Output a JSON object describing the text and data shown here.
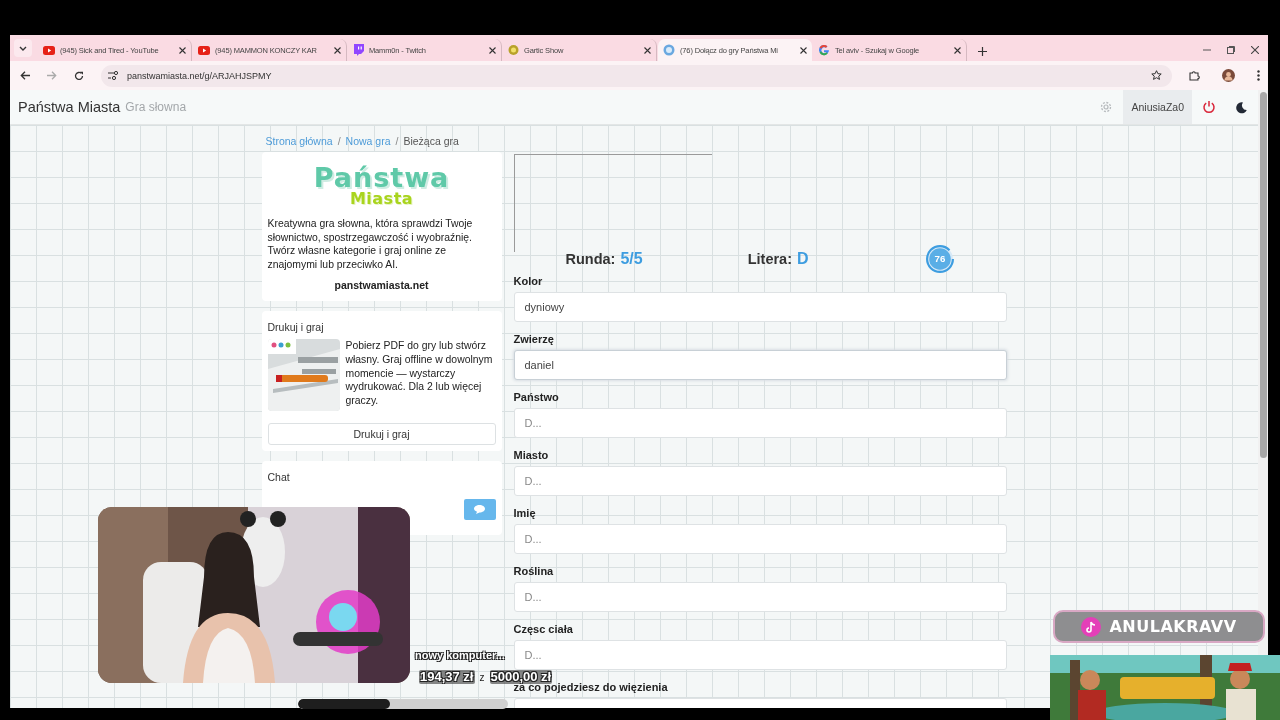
{
  "browser": {
    "tabs": [
      {
        "title": "(945) Sick and Tired - YouTube",
        "kind": "youtube",
        "selected": false
      },
      {
        "title": "(945) MAMMON KONCZY KAR",
        "kind": "youtube",
        "selected": false
      },
      {
        "title": "Mamm0n - Twitch",
        "kind": "twitch",
        "selected": false
      },
      {
        "title": "Gartic Show",
        "kind": "gartic",
        "selected": false
      },
      {
        "title": "(76) Dołącz do gry Państwa Mi",
        "kind": "site",
        "selected": true
      },
      {
        "title": "Tel aviv - Szukaj w Google",
        "kind": "google",
        "selected": false
      }
    ],
    "url": "panstwamiasta.net/g/ARJAHJSPMY"
  },
  "header": {
    "title": "Państwa Miasta",
    "subtitle": "Gra słowna",
    "user": "AniusiaZa0"
  },
  "breadcrumb": [
    {
      "label": "Strona główna",
      "kind": "link"
    },
    {
      "label": "/",
      "kind": "separator"
    },
    {
      "label": "Nowa gra",
      "kind": "link"
    },
    {
      "label": "/",
      "kind": "separator"
    },
    {
      "label": "Bieżąca gra",
      "kind": "current"
    }
  ],
  "logo": {
    "line_1": "Państwa",
    "line_2": "Miasta"
  },
  "intro": {
    "text": "Kreatywna gra słowna, która sprawdzi Twoje słownictwo, spostrzegawczość i wyobraźnię. Twórz własne kategorie i graj online ze znajomymi lub przeciwko AI.",
    "site": "panstwamiasta.net"
  },
  "print_card": {
    "title": "Drukuj i graj",
    "text": "Pobierz PDF do gry lub stwórz własny. Graj offline w dowolnym momencie — wystarczy wydrukować. Dla 2 lub więcej graczy.",
    "button": "Drukuj i graj"
  },
  "chat": {
    "title": "Chat"
  },
  "game": {
    "round_label": "Runda:",
    "round": "5/5",
    "letter_label": "Litera:",
    "letter": "D",
    "timer": "76"
  },
  "fields": [
    {
      "label": "Kolor",
      "value": "dyniowy",
      "focused": false
    },
    {
      "label": "Zwierzę",
      "value": "daniel",
      "focused": true
    },
    {
      "label": "Państwo",
      "placeholder": "D...",
      "focused": false
    },
    {
      "label": "Miasto",
      "placeholder": "D...",
      "focused": false
    },
    {
      "label": "Imię",
      "placeholder": "D...",
      "focused": false
    },
    {
      "label": "Roślina",
      "placeholder": "D...",
      "focused": false
    },
    {
      "label": "Częsc ciała",
      "placeholder": "D...",
      "focused": false
    },
    {
      "label": "za co pojedziesz do więzienia",
      "focused": false
    }
  ],
  "overlay": {
    "tiktok": "ANULAKRAVV",
    "goal": {
      "title": "nowy komputer...",
      "amount": "194,37 zł",
      "separator": "z",
      "target": "5000,00 zł",
      "level": 0.44
    }
  }
}
